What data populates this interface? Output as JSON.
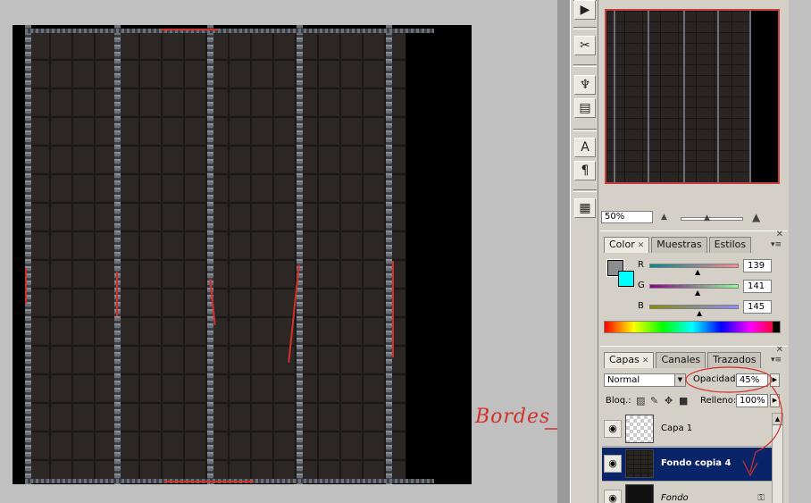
{
  "navigator": {
    "zoom": "50%"
  },
  "color_panel": {
    "tabs": [
      "Color",
      "Muestras",
      "Estilos"
    ],
    "active_tab": "Color",
    "channels": [
      {
        "label": "R",
        "value": "139"
      },
      {
        "label": "G",
        "value": "141"
      },
      {
        "label": "B",
        "value": "145"
      }
    ],
    "foreground_color": "#8b8d91",
    "background_color": "#00ffff"
  },
  "layers_panel": {
    "tabs": [
      "Capas",
      "Canales",
      "Trazados"
    ],
    "active_tab": "Capas",
    "blend_mode": "Normal",
    "opacity_label": "Opacidad:",
    "opacity_value": "45%",
    "lock_label": "Bloq.:",
    "fill_label": "Relleno:",
    "fill_value": "100%",
    "layers": [
      {
        "name": "Capa 1",
        "selected": false
      },
      {
        "name": "Fondo copia 4",
        "selected": true
      },
      {
        "name": "Fondo",
        "selected": false
      }
    ]
  },
  "annotation": {
    "text": "Bordes",
    "color": "#d4302a"
  },
  "icons": {
    "tools": [
      "play-icon",
      "brush-tools-icon",
      "clone-stamp-icon",
      "pattern-icon",
      "text-icon",
      "paragraph-icon",
      "notes-icon"
    ],
    "eye": "eye-icon",
    "lock": "lock-icon"
  }
}
